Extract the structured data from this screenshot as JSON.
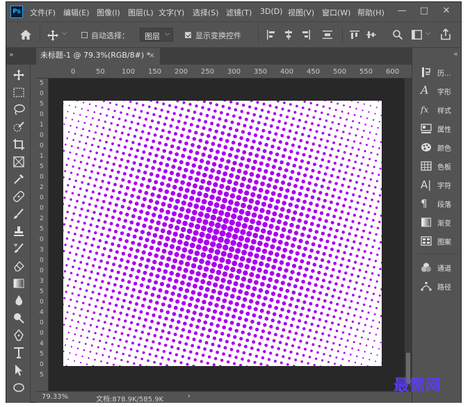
{
  "app": {
    "logo": "Ps"
  },
  "menu": [
    "文件(F)",
    "编辑(E)",
    "图像(I)",
    "图层(L)",
    "文字(Y)",
    "选择(S)",
    "滤镜(T)",
    "3D(D)",
    "视图(V)",
    "窗口(W)",
    "帮助(H)"
  ],
  "window_buttons": {
    "minimize": "—",
    "restore": "□",
    "close": "✕"
  },
  "options": {
    "auto_select_label": "自动选择：",
    "auto_select_checked": false,
    "auto_select_target": "图层",
    "show_transform_label": "显示变换控件",
    "show_transform_checked": true
  },
  "document": {
    "tab_title": "未标题-1 @ 79.3%(RGB/8#) *",
    "tab_close": "×",
    "panel_collapse_left": "»",
    "panel_collapse_right": "«"
  },
  "ruler": {
    "horizontal": [
      "0",
      "50",
      "100",
      "150",
      "200",
      "250",
      "300",
      "350",
      "400",
      "450",
      "500",
      "550",
      "600"
    ],
    "vertical": [
      "5",
      "0",
      "5",
      "0",
      "1",
      "0",
      "0",
      "1",
      "5",
      "0",
      "2",
      "0",
      "0",
      "2",
      "5",
      "0",
      "3",
      "0",
      "0",
      "3",
      "5",
      "0",
      "4",
      "0",
      "0",
      "4",
      "5",
      "0",
      "5"
    ]
  },
  "canvas": {
    "dot_color": "#aa00ee",
    "background": "#ffffff"
  },
  "status": {
    "zoom": "79.33%",
    "doc_info": "文档:878.9K/585.9K",
    "arrow": "›"
  },
  "panels": [
    {
      "name": "history",
      "label": "历...",
      "icon": "history-icon"
    },
    {
      "name": "character",
      "label": "字形",
      "icon": "glyph-icon"
    },
    {
      "name": "styles",
      "label": "样式",
      "icon": "fx-icon"
    },
    {
      "name": "properties",
      "label": "属性",
      "icon": "properties-icon"
    },
    {
      "name": "color",
      "label": "颜色",
      "icon": "palette-icon"
    },
    {
      "name": "swatches",
      "label": "色板",
      "icon": "grid-icon"
    },
    {
      "name": "type",
      "label": "字符",
      "icon": "type-a-icon"
    },
    {
      "name": "paragraph",
      "label": "段落",
      "icon": "pilcrow-icon"
    },
    {
      "name": "gradients",
      "label": "渐变",
      "icon": "gradient-icon"
    },
    {
      "name": "patterns",
      "label": "图案",
      "icon": "pattern-icon"
    },
    {
      "name": "channels",
      "label": "通道",
      "icon": "channels-icon"
    },
    {
      "name": "paths",
      "label": "路径",
      "icon": "path-icon"
    }
  ],
  "watermark": "最需网"
}
